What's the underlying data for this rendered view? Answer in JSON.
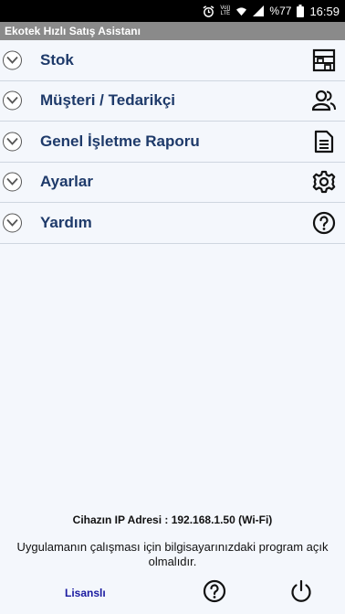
{
  "status_bar": {
    "signal_label_top": "Vo))",
    "signal_label_bottom": "LTE",
    "battery": "%77",
    "time": "16:59"
  },
  "app": {
    "title": "Ekotek Hızlı Satış Asistanı"
  },
  "menu": {
    "items": [
      {
        "label": "Stok",
        "icon": "warehouse-shelf-icon"
      },
      {
        "label": "Müşteri / Tedarikçi",
        "icon": "users-icon"
      },
      {
        "label": "Genel İşletme Raporu",
        "icon": "document-icon"
      },
      {
        "label": "Ayarlar",
        "icon": "gear-icon"
      },
      {
        "label": "Yardım",
        "icon": "help-icon"
      }
    ]
  },
  "footer": {
    "ip_text": "Cihazın IP Adresi : 192.168.1.50 (Wi-Fi)",
    "note": "Uygulamanın çalışması için bilgisayarınızdaki program açık olmalıdır.",
    "license_label": "Lisanslı"
  },
  "colors": {
    "menu_text": "#1e3a6a",
    "license_text": "#1a1aa0",
    "title_bar_bg": "#8a8a8a",
    "background": "#f4f7fc"
  }
}
